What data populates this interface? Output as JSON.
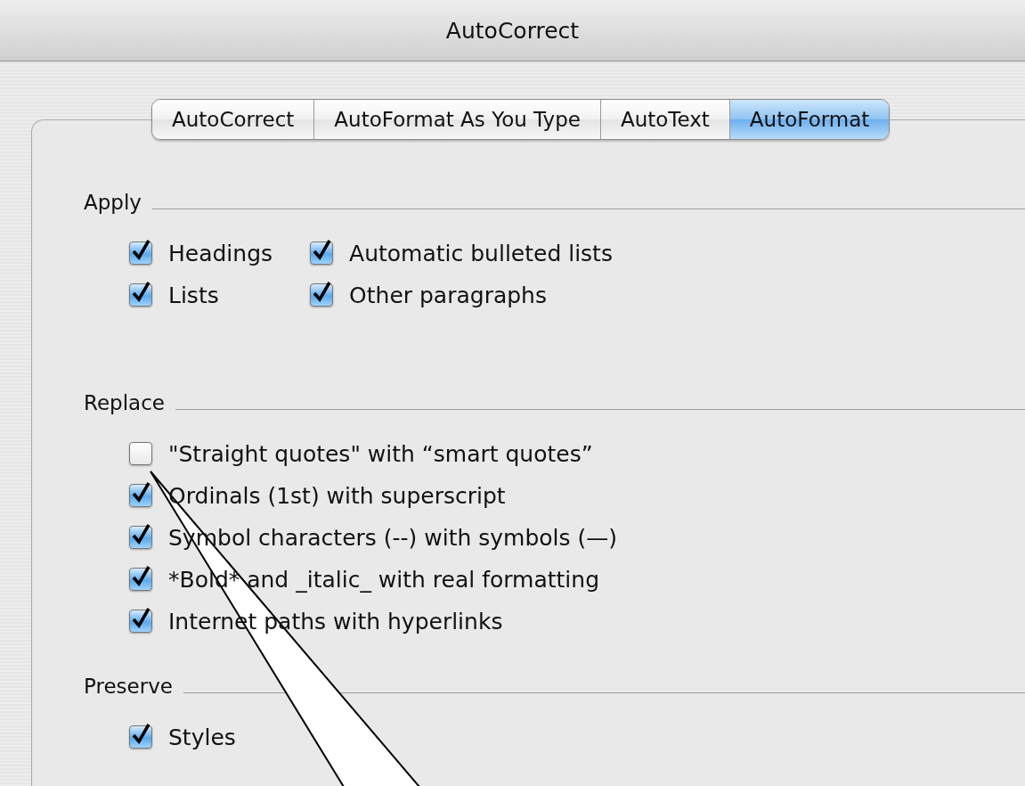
{
  "window": {
    "title": "AutoCorrect"
  },
  "tabs": [
    {
      "label": "AutoCorrect",
      "selected": false
    },
    {
      "label": "AutoFormat As You Type",
      "selected": false
    },
    {
      "label": "AutoText",
      "selected": false
    },
    {
      "label": "AutoFormat",
      "selected": true
    }
  ],
  "sections": [
    {
      "title": "Apply",
      "kind": "grid",
      "options": [
        {
          "label": "Headings",
          "checked": true
        },
        {
          "label": "Automatic bulleted lists",
          "checked": true
        },
        {
          "label": "Lists",
          "checked": true
        },
        {
          "label": "Other paragraphs",
          "checked": true
        }
      ]
    },
    {
      "title": "Replace",
      "kind": "list",
      "options": [
        {
          "label": "\"Straight quotes\" with “smart quotes”",
          "checked": false
        },
        {
          "label": "Ordinals (1st) with superscript",
          "checked": true
        },
        {
          "label": "Symbol characters (--) with symbols (—)",
          "checked": true
        },
        {
          "label": "*Bold* and _italic_ with real formatting",
          "checked": true
        },
        {
          "label": "Internet paths with hyperlinks",
          "checked": true
        }
      ]
    },
    {
      "title": "Preserve",
      "kind": "list",
      "options": [
        {
          "label": "Styles",
          "checked": true
        }
      ]
    }
  ]
}
